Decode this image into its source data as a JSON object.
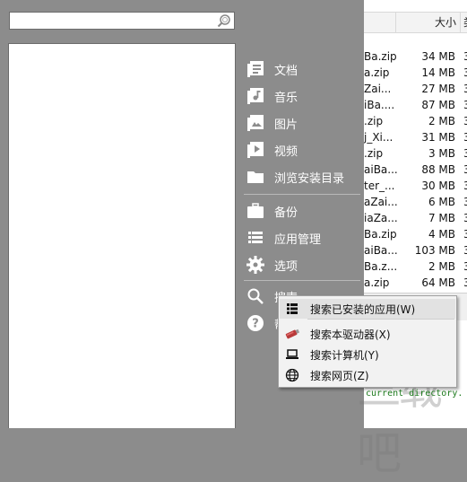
{
  "search": {
    "value": "",
    "placeholder": ""
  },
  "menu": {
    "items": [
      {
        "label": "文档"
      },
      {
        "label": "音乐"
      },
      {
        "label": "图片"
      },
      {
        "label": "视频"
      },
      {
        "label": "浏览安装目录"
      },
      {
        "label": "备份"
      },
      {
        "label": "应用管理"
      },
      {
        "label": "选项"
      },
      {
        "label": "搜索"
      },
      {
        "label": "帮"
      }
    ]
  },
  "file_list": {
    "columns": [
      "",
      "大小",
      "类"
    ],
    "rows": [
      {
        "name": "Ba.zip",
        "size": "34 MB",
        "extra": "3"
      },
      {
        "name": "a.zip",
        "size": "14 MB",
        "extra": "3"
      },
      {
        "name": "Zai...",
        "size": "27 MB",
        "extra": "3"
      },
      {
        "name": "iBa....",
        "size": "87 MB",
        "extra": "3"
      },
      {
        "name": ".zip",
        "size": "2 MB",
        "extra": "3"
      },
      {
        "name": "j_Xi...",
        "size": "31 MB",
        "extra": "3"
      },
      {
        "name": ".zip",
        "size": "3 MB",
        "extra": "3"
      },
      {
        "name": "aiBa...",
        "size": "88 MB",
        "extra": "3"
      },
      {
        "name": "ter_...",
        "size": "30 MB",
        "extra": "3"
      },
      {
        "name": "aZai...",
        "size": "6 MB",
        "extra": "3"
      },
      {
        "name": "iaZa...",
        "size": "7 MB",
        "extra": "3"
      },
      {
        "name": "Ba.zip",
        "size": "4 MB",
        "extra": "3"
      },
      {
        "name": "aiBa...",
        "size": "103 MB",
        "extra": "3"
      },
      {
        "name": "Ba.z...",
        "size": "2 MB",
        "extra": "3"
      },
      {
        "name": "a.zip",
        "size": "64 MB",
        "extra": "3"
      }
    ]
  },
  "context_menu": {
    "items": [
      {
        "label": "搜索已安装的应用(W)",
        "icon": "list-icon"
      },
      {
        "label": "搜索本驱动器(X)",
        "icon": "usb-drive-icon"
      },
      {
        "label": "搜索计算机(Y)",
        "icon": "laptop-icon"
      },
      {
        "label": "搜索网页(Z)",
        "icon": "globe-icon"
      }
    ]
  },
  "terminal": {
    "text": "current directory."
  },
  "colors": {
    "panel": "#8c8c8c",
    "menu_text": "#ffffff",
    "terminal_text": "#1c7a1c"
  }
}
